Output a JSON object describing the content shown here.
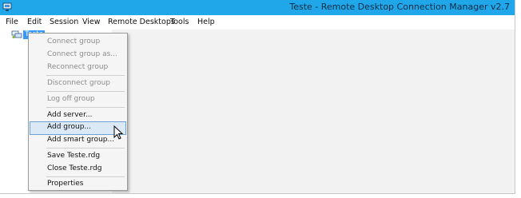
{
  "window": {
    "title": "Teste - Remote Desktop Connection Manager v2.7"
  },
  "menubar": {
    "items": [
      "File",
      "Edit",
      "Session",
      "View",
      "Remote Desktops",
      "Tools",
      "Help"
    ]
  },
  "tree": {
    "root_label": "Teste"
  },
  "context_menu": {
    "items": [
      {
        "label": "Connect group",
        "state": "disabled"
      },
      {
        "label": "Connect group as...",
        "state": "disabled"
      },
      {
        "label": "Reconnect group",
        "state": "disabled"
      },
      {
        "label": "Disconnect group",
        "state": "disabled"
      },
      {
        "label": "Log off group",
        "state": "disabled"
      },
      {
        "label": "Add server...",
        "state": "enabled"
      },
      {
        "label": "Add group...",
        "state": "highlighted"
      },
      {
        "label": "Add smart group...",
        "state": "enabled"
      },
      {
        "label": "Save Teste.rdg",
        "state": "enabled"
      },
      {
        "label": "Close Teste.rdg",
        "state": "enabled"
      },
      {
        "label": "Properties",
        "state": "enabled"
      }
    ]
  },
  "colors": {
    "titlebar": "#20a7ea",
    "selection": "#3399ff",
    "menu_highlight": "#dbe9f7"
  }
}
